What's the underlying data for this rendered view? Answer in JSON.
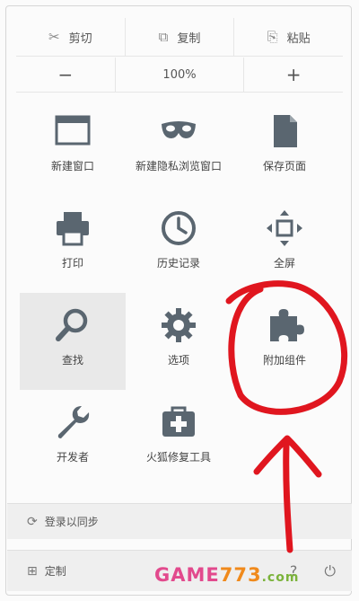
{
  "edit": {
    "cut_label": "剪切",
    "copy_label": "复制",
    "paste_label": "粘贴"
  },
  "zoom": {
    "minus": "−",
    "value": "100%",
    "plus": "+"
  },
  "tiles": [
    {
      "label": "新建窗口",
      "icon": "window-icon"
    },
    {
      "label": "新建隐私浏览窗口",
      "icon": "mask-icon"
    },
    {
      "label": "保存页面",
      "icon": "page-icon"
    },
    {
      "label": "打印",
      "icon": "printer-icon"
    },
    {
      "label": "历史记录",
      "icon": "clock-icon"
    },
    {
      "label": "全屏",
      "icon": "fullscreen-icon"
    },
    {
      "label": "查找",
      "icon": "search-icon"
    },
    {
      "label": "选项",
      "icon": "gear-icon"
    },
    {
      "label": "附加组件",
      "icon": "puzzle-icon"
    },
    {
      "label": "开发者",
      "icon": "wrench-icon"
    },
    {
      "label": "火狐修复工具",
      "icon": "toolkit-icon"
    }
  ],
  "footer": {
    "sync_label": "登录以同步",
    "customize_label": "定制"
  },
  "watermark": {
    "part1": "GAME",
    "part2": "773",
    "part3": ".com"
  },
  "colors": {
    "annotation": "#e0161f",
    "icon": "#5a6670"
  }
}
